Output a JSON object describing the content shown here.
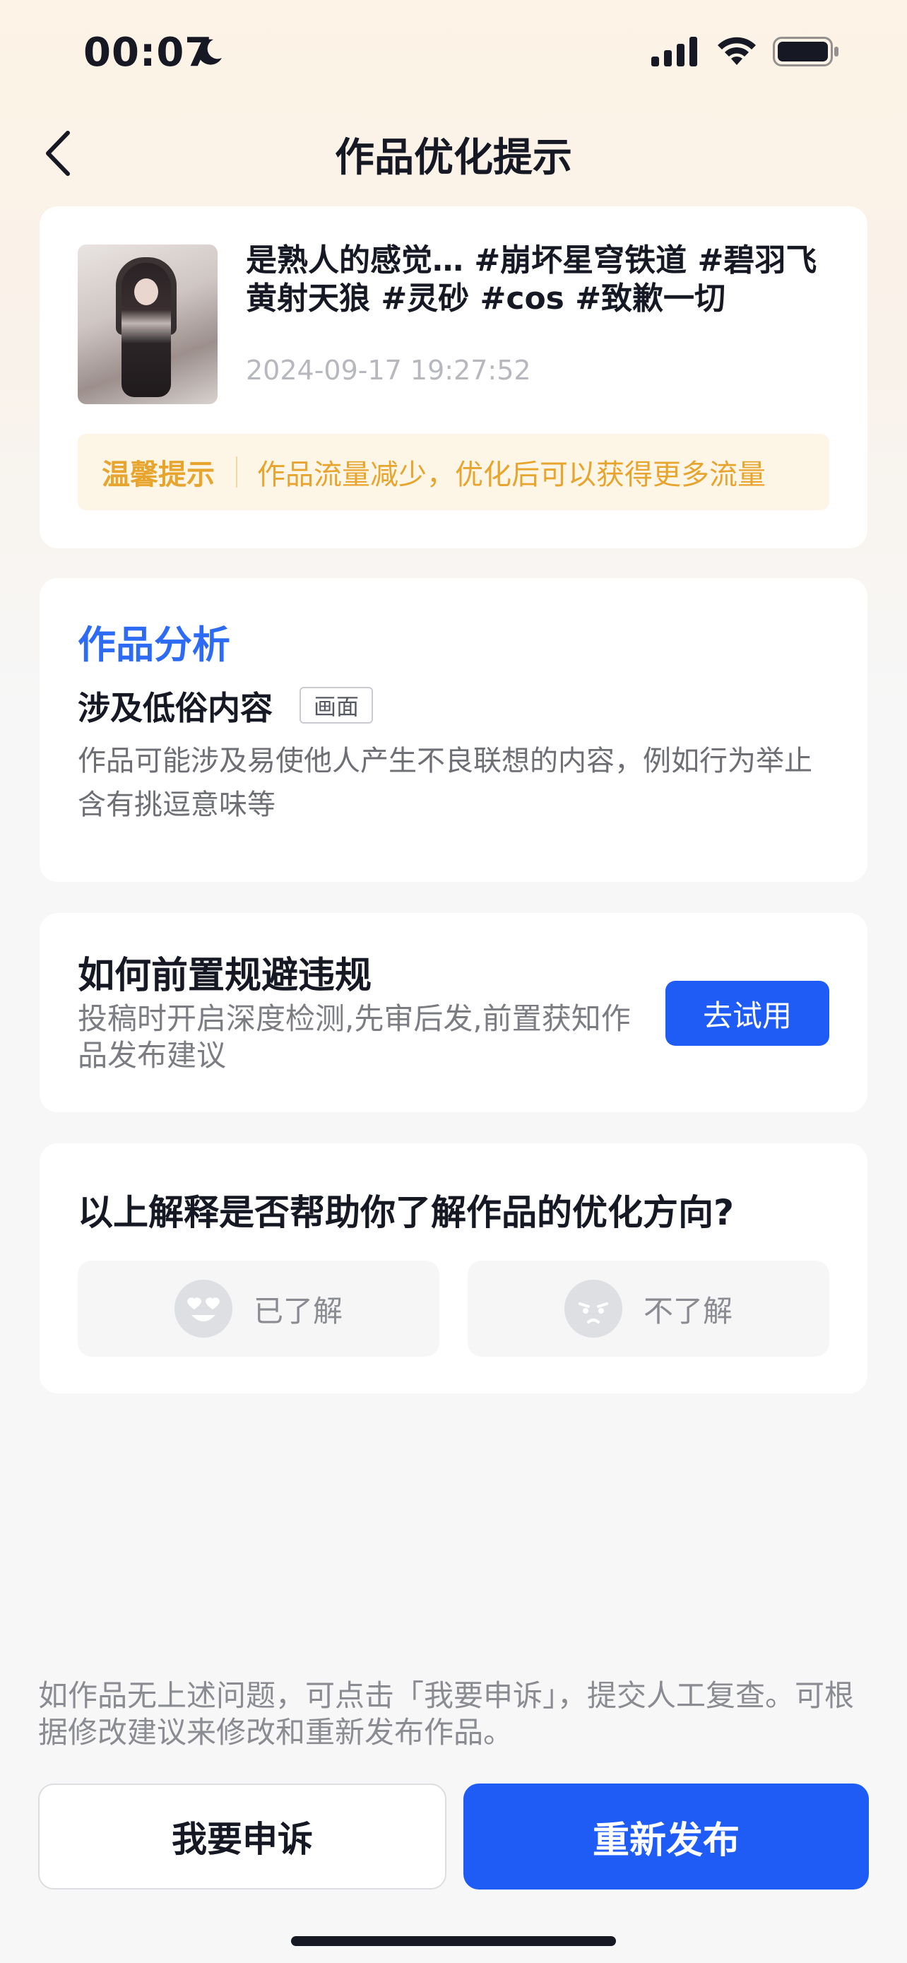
{
  "status_bar": {
    "time": "00:07",
    "icons": [
      "moon-icon",
      "signal-icon",
      "wifi-icon",
      "battery-icon"
    ]
  },
  "nav": {
    "back_icon": "chevron-left-icon",
    "title": "作品优化提示"
  },
  "work": {
    "title": "是熟人的感觉… #崩坏星穹铁道 #碧羽飞黄射天狼 #灵砂 #cos #致歉一切",
    "date": "2024-09-17 19:27:52"
  },
  "tip": {
    "label": "温馨提示",
    "text": "作品流量减少，优化后可以获得更多流量"
  },
  "analysis": {
    "title": "作品分析",
    "issue": "涉及低俗内容",
    "tag": "画面",
    "description": "作品可能涉及易使他人产生不良联想的内容，例如行为举止含有挑逗意味等"
  },
  "prevent": {
    "title": "如何前置规避违规",
    "description": "投稿时开启深度检测,先审后发,前置获知作品发布建议",
    "button": "去试用"
  },
  "feedback": {
    "question": "以上解释是否帮助你了解作品的优化方向?",
    "understood": "已了解",
    "not_understood": "不了解"
  },
  "footer": {
    "note": "如作品无上述问题，可点击「我要申诉」，提交人工复查。可根据修改建议来修改和重新发布作品。",
    "appeal": "我要申诉",
    "republish": "重新发布"
  },
  "colors": {
    "accent": "#1e5cf5",
    "analysis_title": "#2d6bf4",
    "tip_text": "#e7a52f",
    "tip_bg": "#fdf6e6"
  }
}
